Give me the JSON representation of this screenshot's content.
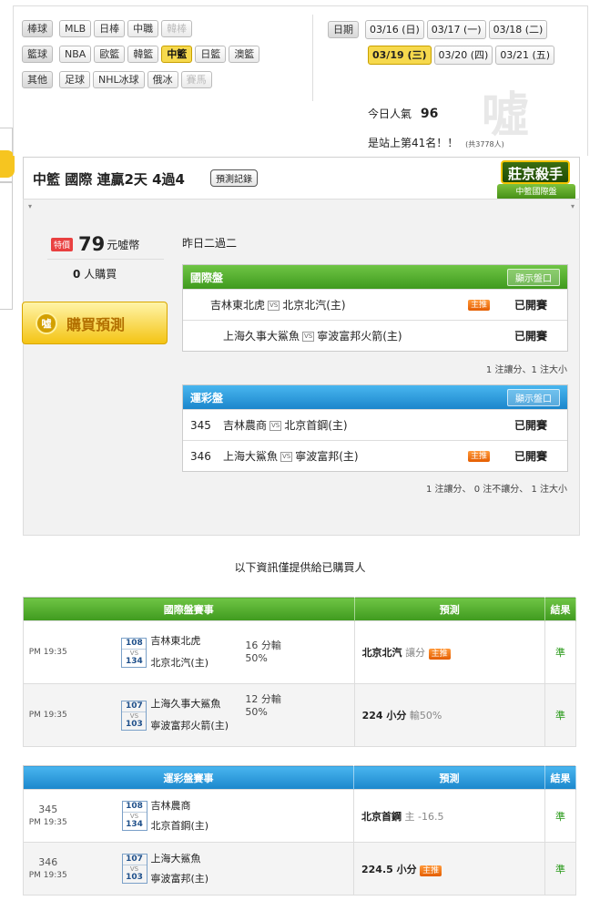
{
  "nav": {
    "rows": [
      {
        "category": "棒球",
        "items": [
          {
            "label": "MLB",
            "state": "normal"
          },
          {
            "label": "日棒",
            "state": "normal"
          },
          {
            "label": "中職",
            "state": "normal"
          },
          {
            "label": "韓棒",
            "state": "disabled"
          }
        ]
      },
      {
        "category": "籃球",
        "items": [
          {
            "label": "NBA",
            "state": "normal"
          },
          {
            "label": "歐籃",
            "state": "normal"
          },
          {
            "label": "韓籃",
            "state": "normal"
          },
          {
            "label": "中籃",
            "state": "active"
          },
          {
            "label": "日籃",
            "state": "normal"
          },
          {
            "label": "澳籃",
            "state": "normal"
          }
        ]
      },
      {
        "category": "其他",
        "items": [
          {
            "label": "足球",
            "state": "normal"
          },
          {
            "label": "NHL冰球",
            "state": "normal"
          },
          {
            "label": "俄冰",
            "state": "normal"
          },
          {
            "label": "賽馬",
            "state": "disabled"
          }
        ]
      }
    ]
  },
  "dates": {
    "label": "日期",
    "row1": [
      "03/16 (日)",
      "03/17 (一)",
      "03/18 (二)"
    ],
    "row2": [
      "03/19 (三)",
      "03/20 (四)",
      "03/21 (五)"
    ],
    "active": "03/19 (三)"
  },
  "popularity": {
    "label": "今日人氣",
    "value": "96",
    "rank_text": "是站上第41名！！",
    "total": "(共3778人)"
  },
  "header": {
    "title": "中籃 國際 連贏2天 4過4",
    "record_button": "預測記錄",
    "emblem_title": "莊京殺手",
    "emblem_sub": "中籃國際盤"
  },
  "purchase": {
    "special_tag": "特價",
    "price": "79",
    "unit": "元噓幣",
    "buyers": "0",
    "buyers_suffix": "人購買",
    "buy_button": "購買預測",
    "coin_label": "噓"
  },
  "yesterday": "昨日二過二",
  "intl_panel": {
    "title": "國際盤",
    "show_button": "顯示盤口",
    "rows": [
      {
        "away": "吉林東北虎",
        "home": "北京北汽(主)",
        "badge": "主推",
        "status": "已開賽"
      },
      {
        "away": "上海久事大鯊魚",
        "home": "寧波富邦火箭(主)",
        "badge": "",
        "status": "已開賽"
      }
    ],
    "note": "1 注讓分、1 注大小"
  },
  "lottery_panel": {
    "title": "運彩盤",
    "show_button": "顯示盤口",
    "rows": [
      {
        "num": "345",
        "away": "吉林農商",
        "home": "北京首鋼(主)",
        "badge": "",
        "status": "已開賽"
      },
      {
        "num": "346",
        "away": "上海大鯊魚",
        "home": "寧波富邦(主)",
        "badge": "主推",
        "status": "已開賽"
      }
    ],
    "note": "1 注讓分、 0 注不讓分、 1 注大小"
  },
  "info_note": "以下資訊僅提供給已購買人",
  "vs_text": "VS",
  "intl_table": {
    "headers": [
      "國際盤賽事",
      "預測",
      "結果"
    ],
    "rows": [
      {
        "time": "PM 19:35",
        "num": "",
        "score_away": "108",
        "score_home": "134",
        "away": "吉林東北虎",
        "home": "北京北汽(主)",
        "line1": "16 分輸",
        "line2": "50%",
        "pred": "北京北汽",
        "pred_extra": "讓分",
        "badge": "主推",
        "result": "準"
      },
      {
        "time": "PM 19:35",
        "num": "",
        "score_away": "107",
        "score_home": "103",
        "away": "上海久事大鯊魚",
        "home": "寧波富邦火箭(主)",
        "line1": "12 分輸",
        "line2": "50%",
        "pred": "224 小分",
        "pred_extra": "輸50%",
        "badge": "",
        "result": "準"
      }
    ]
  },
  "lottery_table": {
    "headers": [
      "運彩盤賽事",
      "預測",
      "結果"
    ],
    "rows": [
      {
        "num": "345",
        "time": "PM 19:35",
        "score_away": "108",
        "score_home": "134",
        "away": "吉林農商",
        "home": "北京首鋼(主)",
        "pred": "北京首鋼",
        "pred_extra": "主 -16.5",
        "badge": "",
        "result": "準"
      },
      {
        "num": "346",
        "time": "PM 19:35",
        "score_away": "107",
        "score_home": "103",
        "away": "上海大鯊魚",
        "home": "寧波富邦(主)",
        "pred": "224.5 小分",
        "pred_extra": "",
        "badge": "主推",
        "result": "準"
      }
    ]
  },
  "colors": {
    "active": "#f6d94d",
    "green": "#4aa828",
    "blue": "#2a95d8",
    "badge": "#f07a1a",
    "win": "#2a9a1a"
  }
}
